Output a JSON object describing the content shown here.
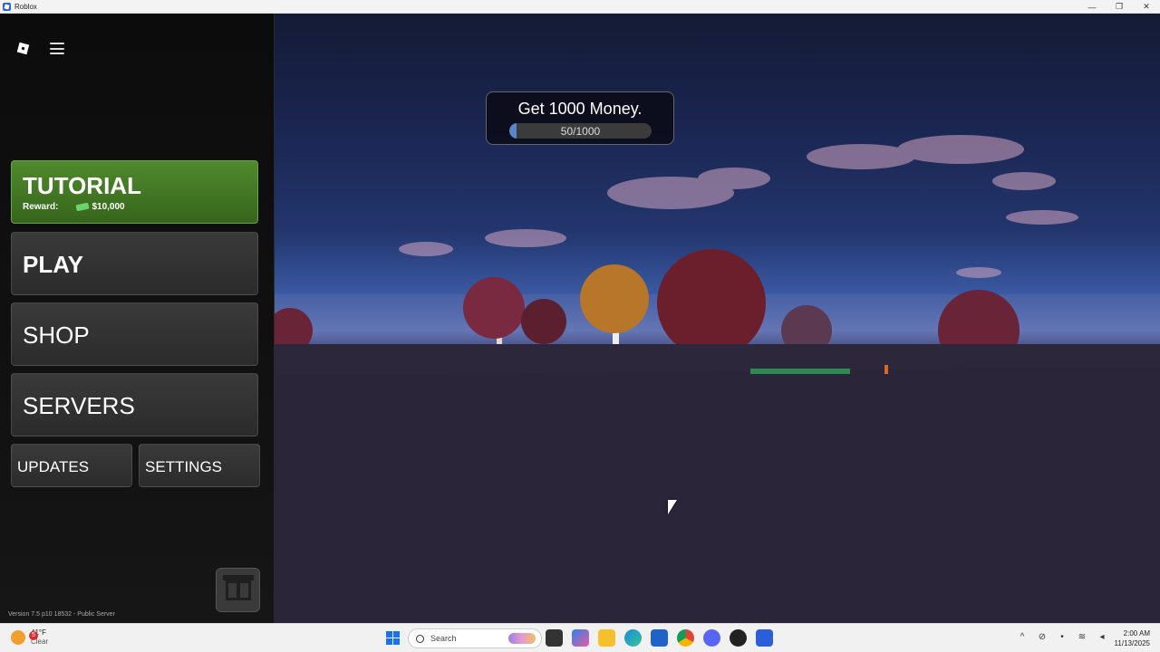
{
  "window": {
    "title": "Roblox",
    "controls": {
      "minimize": "—",
      "restore": "❐",
      "close": "✕"
    }
  },
  "sidebar": {
    "logo_icon": "roblox-logo-icon",
    "menu_icon": "hamburger-menu-icon",
    "tutorial": {
      "label": "TUTORIAL",
      "reward_label": "Reward:",
      "reward_value": "$10,000",
      "color": "#4f8a2c"
    },
    "play": {
      "label": "PLAY"
    },
    "shop": {
      "label": "SHOP"
    },
    "servers": {
      "label": "SERVERS"
    },
    "updates": {
      "label": "UPDATES"
    },
    "settings": {
      "label": "SETTINGS"
    },
    "gift_icon": "gift-icon",
    "version": "Version 7.5 p10 18532 - Public Server"
  },
  "quest": {
    "title": "Get 1000 Money.",
    "progress_text": "50/1000",
    "progress_fraction": 0.05,
    "fill_color": "#5b86c7"
  },
  "taskbar": {
    "weather": {
      "badge": "5",
      "temp": "41°F",
      "condition": "Clear"
    },
    "search_placeholder": "Search",
    "apps": [
      "task-view-icon",
      "copilot-icon",
      "file-explorer-icon",
      "edge-icon",
      "outlook-icon",
      "chrome-icon",
      "discord-icon",
      "github-icon",
      "roblox-icon"
    ],
    "tray_icons": [
      "chevron-up-icon",
      "camera-off-icon",
      "mic-icon",
      "wifi-icon",
      "volume-icon"
    ],
    "time": "2:00 AM",
    "date": "11/13/2025"
  }
}
